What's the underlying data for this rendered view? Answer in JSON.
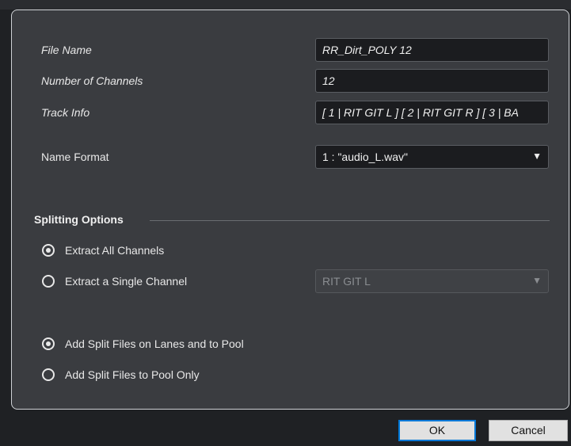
{
  "fields": {
    "file_name_label": "File Name",
    "file_name_value": "RR_Dirt_POLY 12",
    "channels_label": "Number of Channels",
    "channels_value": "12",
    "track_info_label": "Track Info",
    "track_info_value": "[ 1 | RIT GIT L ]  [ 2 | RIT GIT R ]  [ 3 | BA",
    "name_format_label": "Name Format",
    "name_format_value": "1 : \"audio_L.wav\"",
    "dropdown_arrow": "▼"
  },
  "splitting": {
    "title": "Splitting Options",
    "extract_all": "Extract All Channels",
    "extract_single": "Extract a Single Channel",
    "single_channel_value": "RIT GIT L",
    "add_lanes_pool": "Add Split Files on Lanes and to Pool",
    "add_pool_only": "Add Split Files to Pool Only"
  },
  "buttons": {
    "ok": "OK",
    "cancel": "Cancel"
  },
  "colors": {
    "panel_bg": "#3a3c40",
    "window_bg": "#1f2124",
    "focus_blue": "#0078d7"
  }
}
